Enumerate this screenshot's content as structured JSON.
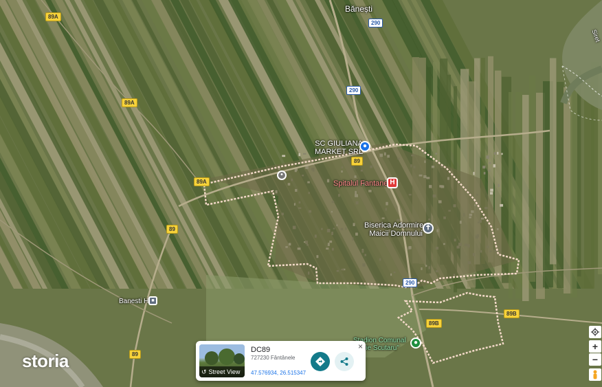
{
  "map": {
    "labels": {
      "banesti_top": "Bănești",
      "giuliana_line1": "SC GIULIANA",
      "giuliana_line2": "MARKET SRL",
      "spital": "Spitalul Fantanele",
      "biserica_line1": "Biserica Adormirea",
      "biserica_line2": "Maicii Domnului",
      "banesti_h": "Banesti H.",
      "stadion_line1": "Stadion Comunal",
      "stadion_line2": "\"Ilie Scutaru\"",
      "river": "Siret"
    },
    "shields": {
      "r89a_1": "89A",
      "r89a_2": "89A",
      "r89a_3": "89A",
      "r89_1": "89",
      "r89_2": "89",
      "r89_3": "89",
      "r89b_1": "89B",
      "r89b_2": "89B",
      "r290_1": "290",
      "r290_2": "290",
      "r290_3": "290"
    },
    "colors": {
      "boundary": "#f3d9c8",
      "pin_blue": "#1a73e8",
      "pin_red": "#e03a3a",
      "pin_green": "#1e8e3e",
      "action_teal": "#137a8a"
    }
  },
  "brand": {
    "logo": "storia"
  },
  "info_card": {
    "title": "DC89",
    "subtitle": "727230 Fântânele",
    "coords": "47.576934, 26.515347",
    "street_view": "Street View",
    "close": "×"
  },
  "controls": {
    "zoom_in": "+",
    "zoom_out": "−"
  }
}
